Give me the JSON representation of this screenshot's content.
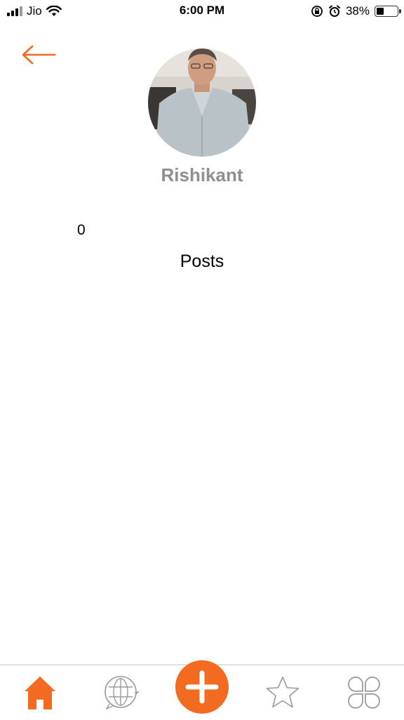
{
  "status_bar": {
    "carrier": "Jio",
    "time": "6:00 PM",
    "battery_percent_text": "38%",
    "battery_level": 0.38
  },
  "colors": {
    "accent": "#f26b21",
    "name_gray": "#8e8e93",
    "icon_gray": "#9a9a9a"
  },
  "header": {
    "back_icon": "arrow-left-icon",
    "profile_name": "Rishikant"
  },
  "stats": {
    "posts_count": "0",
    "posts_label": "Posts"
  },
  "tab_bar": {
    "items": [
      {
        "icon": "home-icon",
        "active": true
      },
      {
        "icon": "globe-chat-icon",
        "active": false
      },
      {
        "icon": "plus-icon",
        "active": false
      },
      {
        "icon": "star-icon",
        "active": false
      },
      {
        "icon": "apps-grid-icon",
        "active": false
      }
    ]
  }
}
